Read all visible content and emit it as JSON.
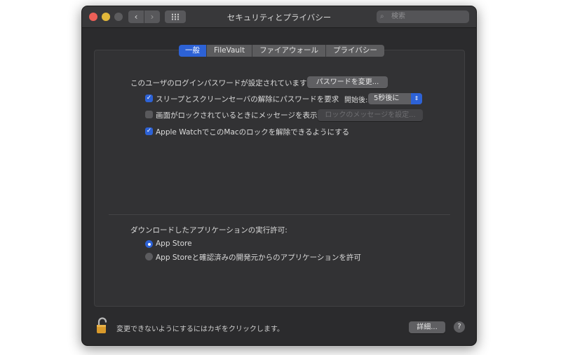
{
  "window": {
    "title": "セキュリティとプライバシー",
    "search_placeholder": "検索",
    "back_glyph": "‹",
    "forward_glyph": "›",
    "search_glyph": "⌕"
  },
  "tabs": [
    {
      "label": "一般",
      "active": true
    },
    {
      "label": "FileVault",
      "active": false
    },
    {
      "label": "ファイアウォール",
      "active": false
    },
    {
      "label": "プライバシー",
      "active": false
    }
  ],
  "general": {
    "password_text": "このユーザのログインパスワードが設定されています",
    "change_password_button": "パスワードを変更...",
    "require_password": {
      "label": "スリープとスクリーンセーバの解除にパスワードを要求",
      "checked": true,
      "delay_label": "開始後:",
      "delay_value": "5秒後に"
    },
    "lock_message": {
      "label": "画面がロックされているときにメッセージを表示",
      "checked": false,
      "button": "ロックのメッセージを設定..."
    },
    "apple_watch": {
      "label": "Apple WatchでこのMacのロックを解除できるようにする",
      "checked": true
    },
    "downloads": {
      "heading": "ダウンロードしたアプリケーションの実行許可:",
      "options": [
        {
          "label": "App Store",
          "selected": true
        },
        {
          "label": "App Storeと確認済みの開発元からのアプリケーションを許可",
          "selected": false
        }
      ]
    }
  },
  "footer": {
    "lock_text": "変更できないようにするにはカギをクリックします。",
    "advanced_button": "詳細...",
    "help_glyph": "?"
  },
  "glyphs": {
    "check": "✓",
    "updown": "⇕"
  },
  "icons": [
    "lock-icon",
    "search-icon",
    "grid-icon",
    "help-icon"
  ],
  "colors": {
    "accent": "#2d62d6",
    "window_bg": "#2b2b2d",
    "lock": "#d99a2b"
  }
}
